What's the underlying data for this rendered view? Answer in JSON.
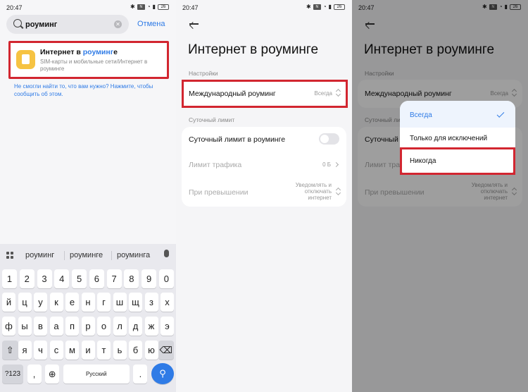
{
  "status": {
    "time": "20:47",
    "battery": "26"
  },
  "search": {
    "query": "роуминг",
    "cancel": "Отмена"
  },
  "result": {
    "title_prefix": "Интернет в ",
    "title_highlight": "роуминг",
    "title_suffix": "е",
    "desc": "SIM-карты и мобильные сети/Интернет в роуминге"
  },
  "notfound": "Не смогли найти то, что вам нужно? Нажмите, чтобы сообщить об этом.",
  "keyboard": {
    "suggestions": [
      "роуминг",
      "роуминге",
      "роуминга"
    ],
    "row_nums": [
      "1",
      "2",
      "3",
      "4",
      "5",
      "6",
      "7",
      "8",
      "9",
      "0"
    ],
    "row1": [
      "й",
      "ц",
      "у",
      "к",
      "е",
      "н",
      "г",
      "ш",
      "щ",
      "з",
      "х"
    ],
    "row2": [
      "ф",
      "ы",
      "в",
      "а",
      "п",
      "р",
      "о",
      "л",
      "д",
      "ж",
      "э"
    ],
    "row3": [
      "я",
      "ч",
      "с",
      "м",
      "и",
      "т",
      "ь",
      "б",
      "ю"
    ],
    "sym": "?123",
    "comma": ",",
    "space": "Русский",
    "dot": "."
  },
  "settings": {
    "title": "Интернет в роуминге",
    "section_settings": "Настройки",
    "intl_roaming": "Международный роуминг",
    "intl_roaming_value": "Всегда",
    "section_daily": "Суточный лимит",
    "daily_limit": "Суточный лимит в роуминге",
    "traffic_limit": "Лимит трафика",
    "traffic_limit_value": "0 Б",
    "on_exceed": "При превышении",
    "on_exceed_value": "Уведомлять и отключать интернет"
  },
  "popup": {
    "options": [
      "Всегда",
      "Только для исключений",
      "Никогда"
    ]
  },
  "colors": {
    "accent": "#2f7be6",
    "highlight_border": "#d22630"
  }
}
